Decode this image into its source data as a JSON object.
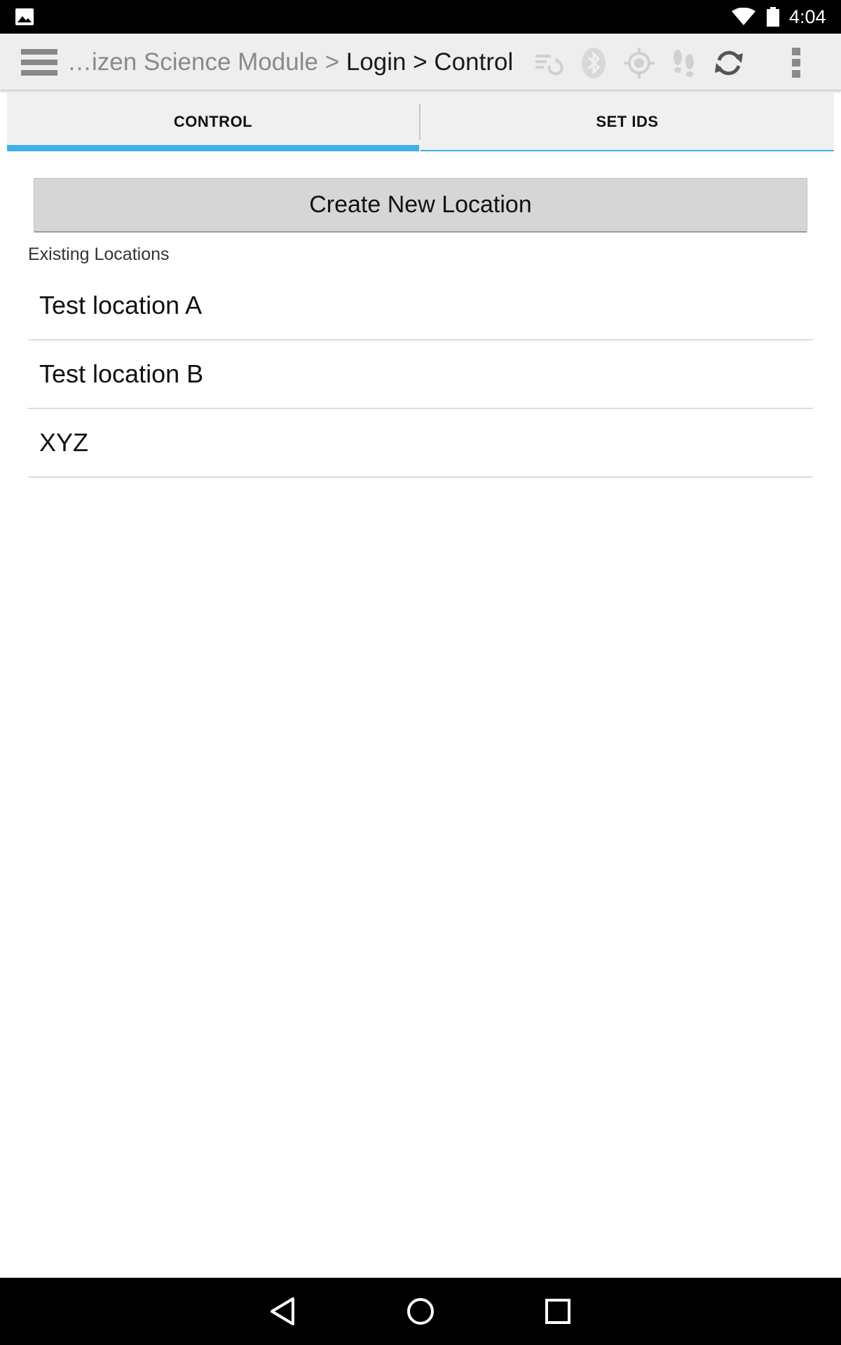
{
  "status_bar": {
    "time": "4:04",
    "icons": [
      "gallery-icon",
      "wifi-icon",
      "battery-icon"
    ]
  },
  "action_bar": {
    "breadcrumb_dim": "…izen Science Module >",
    "breadcrumb_active": "Login > Control",
    "icons": [
      "nav-drawer-icon",
      "sync-list-icon",
      "bluetooth-icon",
      "gps-icon",
      "footsteps-icon",
      "refresh-icon",
      "overflow-menu-icon"
    ],
    "colors": {
      "background": "#eeeeee",
      "icon_disabled": "#d0d0d0",
      "icon_active": "#555555"
    }
  },
  "tabs": [
    {
      "label": "CONTROL",
      "selected": true
    },
    {
      "label": "SET IDS",
      "selected": false
    }
  ],
  "accent_color": "#3fb0e5",
  "main": {
    "create_button_label": "Create New Location",
    "section_label": "Existing Locations",
    "locations": [
      "Test location A",
      "Test location B",
      "XYZ"
    ]
  },
  "nav_bar": {
    "icons": [
      "back-icon",
      "home-icon",
      "recents-icon"
    ]
  }
}
